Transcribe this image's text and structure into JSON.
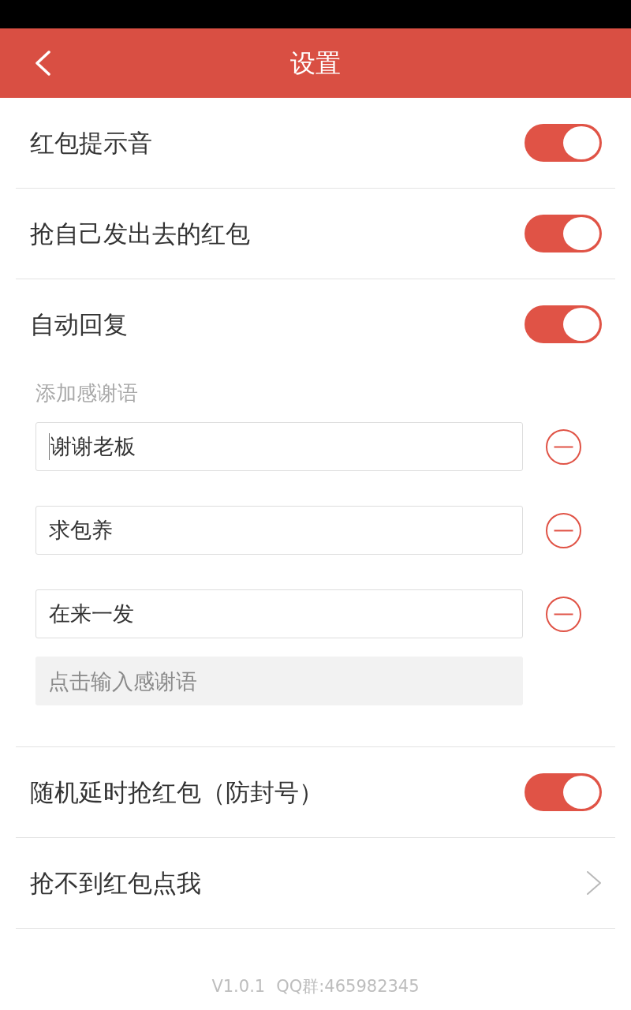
{
  "header": {
    "title": "设置"
  },
  "settings": [
    {
      "kind": "toggle",
      "label": "红包提示音",
      "on": true
    },
    {
      "kind": "toggle",
      "label": "抢自己发出去的红包",
      "on": true
    },
    {
      "kind": "toggle",
      "label": "自动回复",
      "on": true
    },
    {
      "kind": "phrases",
      "label": "添加感谢语",
      "phrases": [
        {
          "value": "谢谢老板",
          "focused": true
        },
        {
          "value": "求包养",
          "focused": false
        },
        {
          "value": "在来一发",
          "focused": false
        }
      ],
      "new_phrase": {
        "placeholder": "点击输入感谢语"
      }
    },
    {
      "kind": "toggle",
      "label": "随机延时抢红包（防封号）",
      "on": true
    },
    {
      "kind": "link",
      "label": "抢不到红包点我"
    }
  ],
  "footer": {
    "version": "V1.0.1",
    "qq_group": "QQ群:465982345"
  }
}
